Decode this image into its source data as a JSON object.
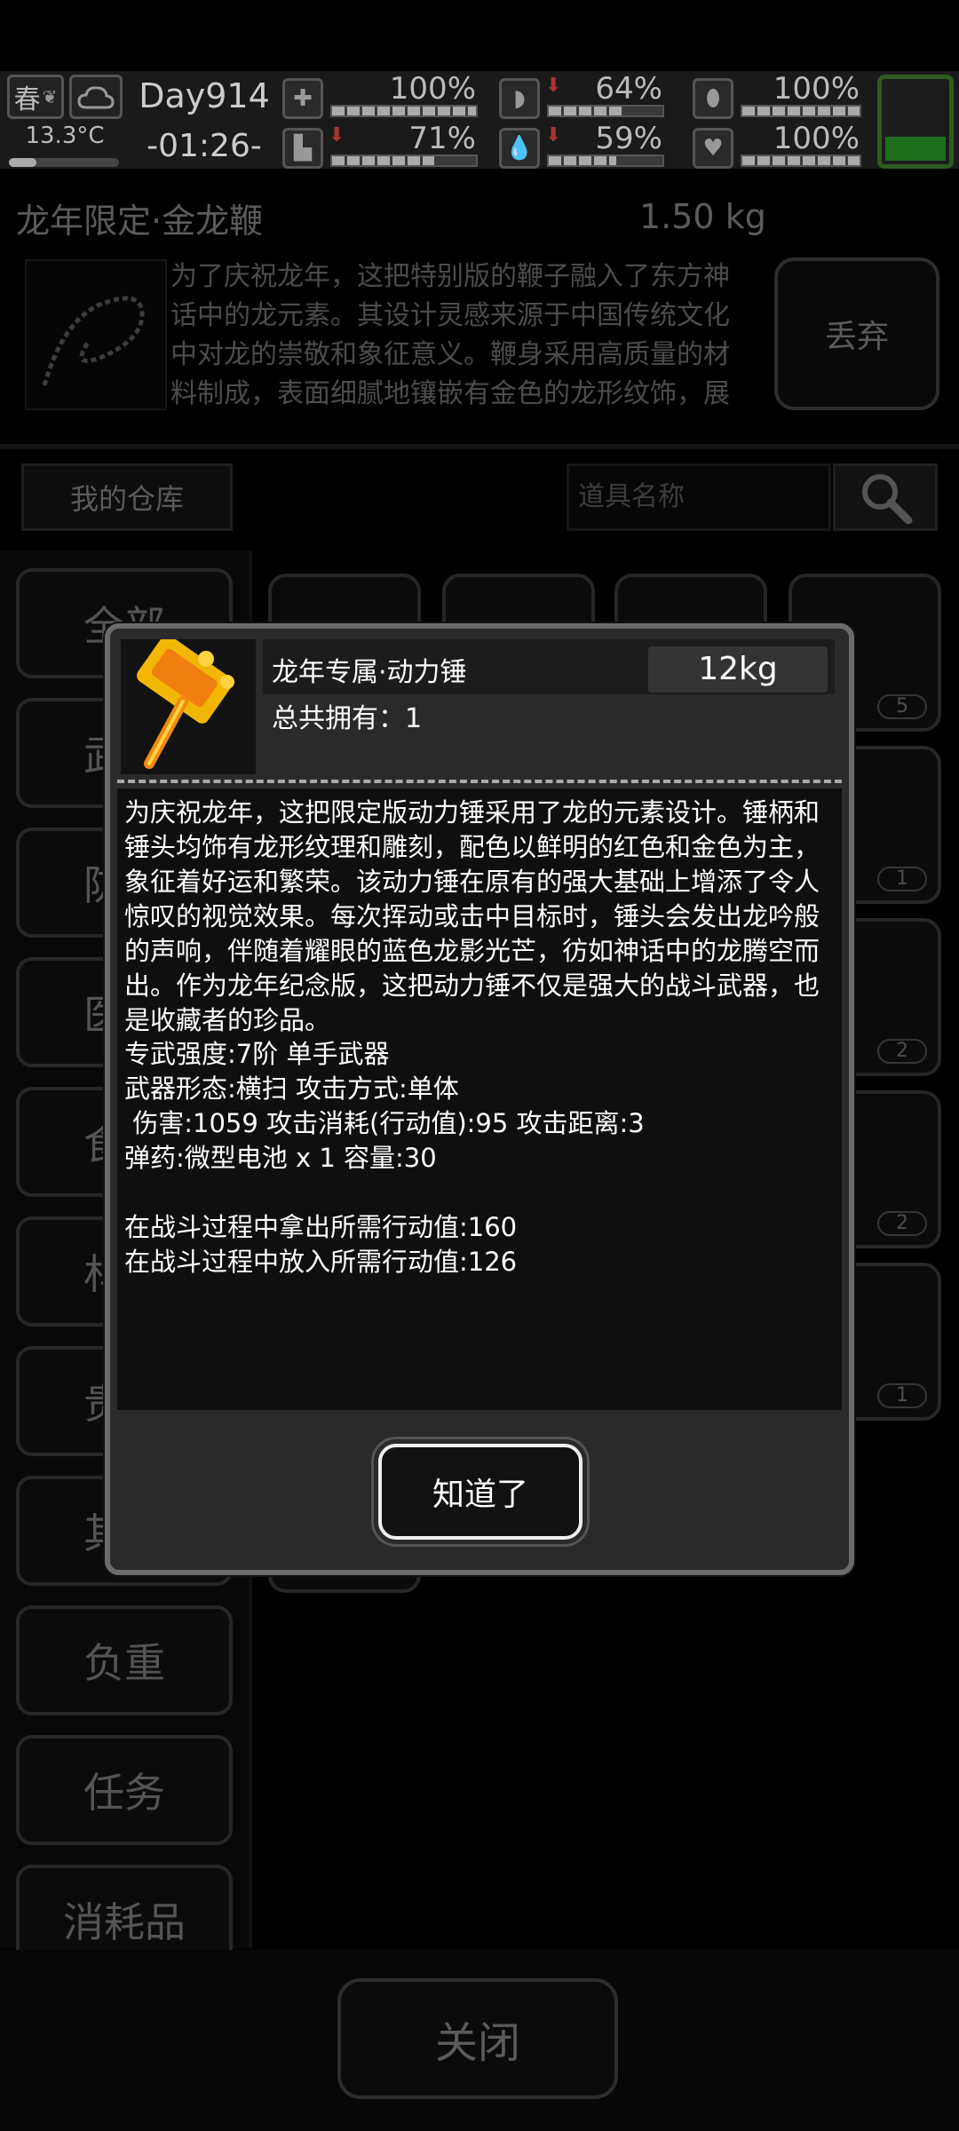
{
  "status": {
    "season": "春",
    "temperature": "13.3°C",
    "temperature_level": 0.25,
    "day": "Day914",
    "time": "-01:26-",
    "stats": [
      {
        "icon": "medkit-icon",
        "value": "100%",
        "fill": 1.0,
        "declining": false
      },
      {
        "icon": "stomach-icon",
        "value": "64%",
        "fill": 0.64,
        "declining": true
      },
      {
        "icon": "mask-icon",
        "value": "100%",
        "fill": 1.0,
        "declining": false
      },
      {
        "icon": "boot-icon",
        "value": "71%",
        "fill": 0.71,
        "declining": true
      },
      {
        "icon": "water-drop-icon",
        "value": "59%",
        "fill": 0.59,
        "declining": true
      },
      {
        "icon": "heart-icon",
        "value": "100%",
        "fill": 1.0,
        "declining": false
      }
    ],
    "battery_level": 0.3
  },
  "selected_item": {
    "name": "龙年限定·金龙鞭",
    "weight": "1.50 kg",
    "description": "为了庆祝龙年，这把特别版的鞭子融入了东方神话中的龙元素。其设计灵感来源于中国传统文化中对龙的崇敬和象征意义。鞭身采用高质量的材料制成，表面细腻地镶嵌有金色的龙形纹饰，展现出精美绝伦的工艺水平。当挥舞这把鞭子时",
    "discard_label": "丢弃"
  },
  "warehouse": {
    "label": "我的仓库",
    "search_placeholder": "道具名称"
  },
  "categories": [
    "全部",
    "武器",
    "防具",
    "医疗",
    "食物",
    "材料",
    "贵重",
    "其他",
    "负重",
    "任务",
    "消耗品"
  ],
  "grid_counts": [
    "5",
    "1",
    "2",
    "2",
    "1"
  ],
  "close_label": "关闭",
  "modal": {
    "title": "龙年专属·动力锤",
    "weight": "12kg",
    "owned": "总共拥有：1",
    "description": "为庆祝龙年，这把限定版动力锤采用了龙的元素设计。锤柄和锤头均饰有龙形纹理和雕刻，配色以鲜明的红色和金色为主，象征着好运和繁荣。该动力锤在原有的强大基础上增添了令人惊叹的视觉效果。每次挥动或击中目标时，锤头会发出龙吟般的声响，伴随着耀眼的蓝色龙影光芒，彷如神话中的龙腾空而出。作为龙年纪念版，这把动力锤不仅是强大的战斗武器，也是收藏者的珍品。",
    "lines": [
      "专武强度:7阶 单手武器",
      "武器形态:横扫 攻击方式:单体",
      " 伤害:1059 攻击消耗(行动值):95 攻击距离:3",
      "弹药:微型电池 x 1 容量:30",
      "",
      "在战斗过程中拿出所需行动值:160",
      "在战斗过程中放入所需行动值:126"
    ],
    "ok_label": "知道了"
  }
}
